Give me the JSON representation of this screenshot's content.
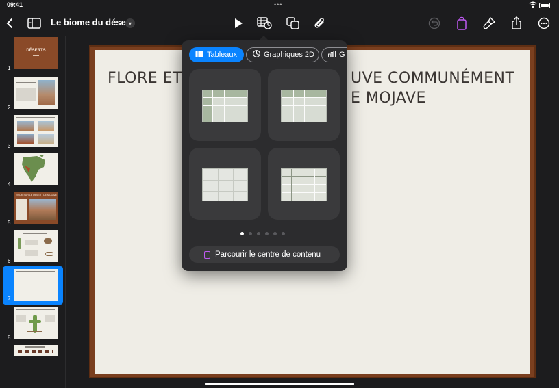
{
  "status_bar": {
    "time": "09:41",
    "dots": "•••"
  },
  "toolbar": {
    "doc_title": "Le biome du désert",
    "icons": [
      "back-chevron-icon",
      "sidebar-icon",
      "title-menu-chevron-icon",
      "play-icon",
      "insert-table-chart-icon",
      "shapes-icon",
      "attachment-icon",
      "undo-icon",
      "content-center-bag-icon",
      "format-brush-icon",
      "share-icon",
      "more-icon"
    ]
  },
  "navigator": {
    "slides": [
      {
        "num": "1",
        "title": "DÉSERTS"
      },
      {
        "num": "2",
        "title": ""
      },
      {
        "num": "3",
        "title": ""
      },
      {
        "num": "4",
        "title": ""
      },
      {
        "num": "5",
        "title": "ZOOM SUR LE DÉSERT DE MOJAVE"
      },
      {
        "num": "6",
        "title": ""
      },
      {
        "num": "7",
        "title": ""
      },
      {
        "num": "8",
        "title": ""
      }
    ],
    "selected": "7",
    "add_slide": "+"
  },
  "slide": {
    "title": "FLORE ET FAUNE QUE L'ON TROUVE COMMUNÉMENT DANS LE DÉSERT DE MOJAVE",
    "title_visible_line1_left": "FLORE ET",
    "title_visible_line1_right": "UVE COMMUNÉMENT",
    "title_visible_line2_right": "E MOJAVE"
  },
  "popover": {
    "tabs": [
      {
        "label": "Tableaux",
        "icon": "table-icon",
        "active": true
      },
      {
        "label": "Graphiques 2D",
        "icon": "chart-2d-icon",
        "active": false
      },
      {
        "label": "G",
        "icon": "chart-3d-icon",
        "active": false
      }
    ],
    "page_count": 6,
    "current_page": 1,
    "browse_label": "Parcourir le centre de contenu"
  },
  "colors": {
    "accent": "#0a84ff",
    "purple": "#bf5af2",
    "slide_frame": "#7a3f1f",
    "slide_paper": "#efede6"
  }
}
